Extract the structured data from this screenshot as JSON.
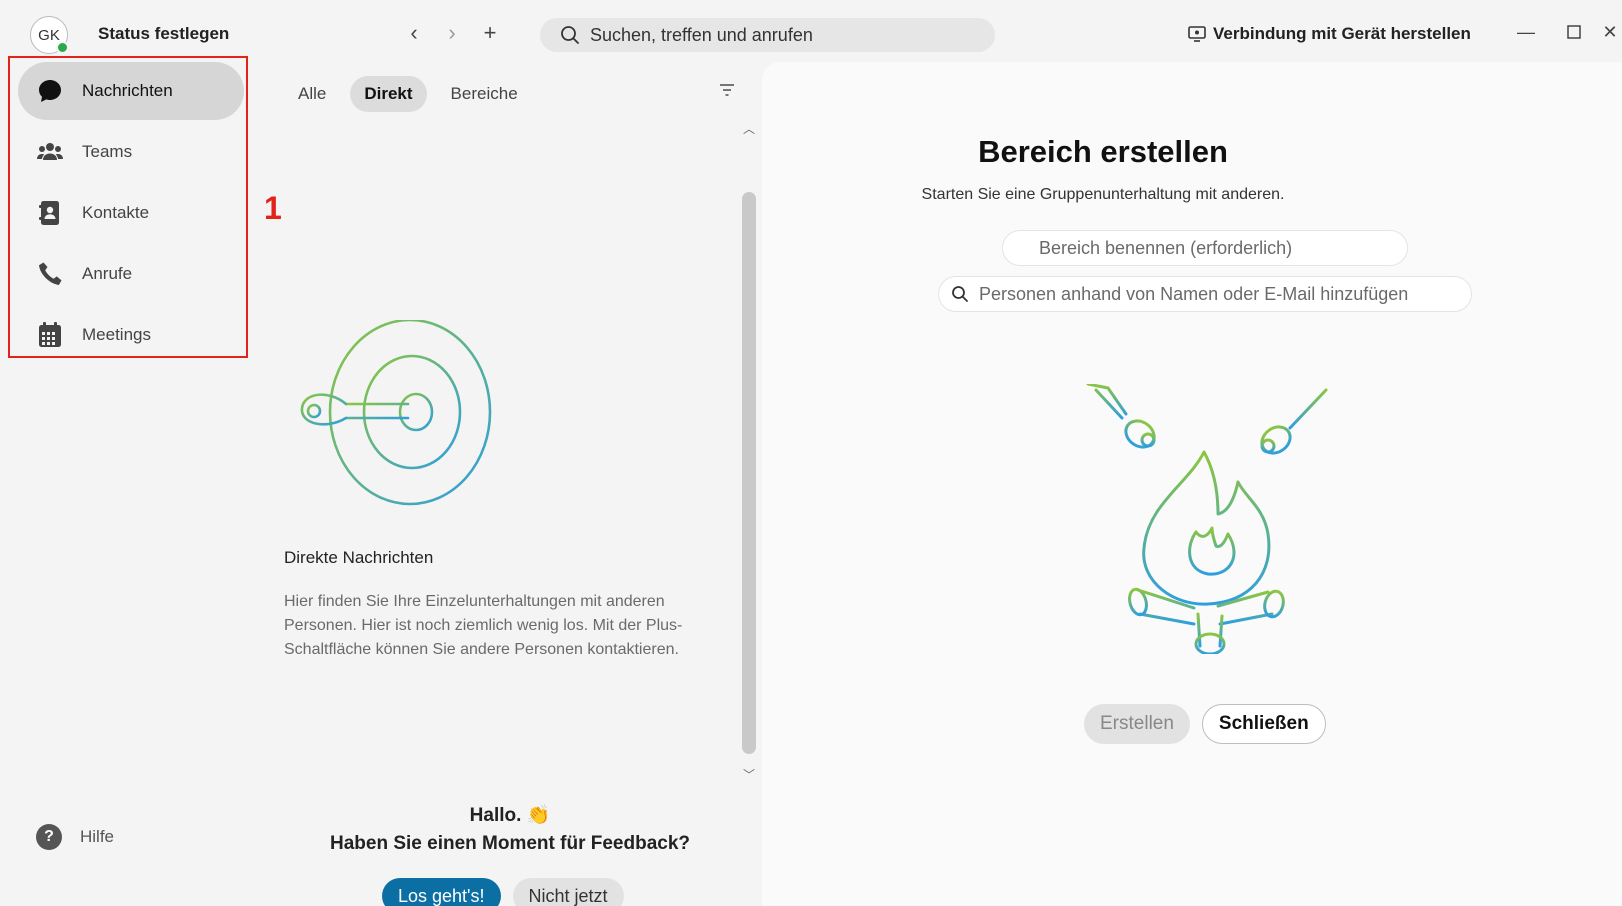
{
  "titlebar": {
    "avatar_initials": "GK",
    "status_label": "Status festlegen",
    "search_placeholder": "Suchen, treffen und anrufen",
    "connect_label": "Verbindung mit Gerät herstellen"
  },
  "sidebar": {
    "items": [
      {
        "label": "Nachrichten",
        "icon": "chat-bubble-icon",
        "active": true
      },
      {
        "label": "Teams",
        "icon": "people-icon",
        "active": false
      },
      {
        "label": "Kontakte",
        "icon": "contacts-book-icon",
        "active": false
      },
      {
        "label": "Anrufe",
        "icon": "phone-icon",
        "active": false
      },
      {
        "label": "Meetings",
        "icon": "calendar-icon",
        "active": false
      }
    ],
    "help_label": "Hilfe",
    "annotation_number": "1"
  },
  "list_panel": {
    "filters": [
      {
        "label": "Alle",
        "active": false
      },
      {
        "label": "Direkt",
        "active": true
      },
      {
        "label": "Bereiche",
        "active": false
      }
    ],
    "empty_title": "Direkte Nachrichten",
    "empty_description": "Hier finden Sie Ihre Einzelunterhaltungen mit anderen Personen. Hier ist noch ziemlich wenig los. Mit der Plus-Schaltfläche können Sie andere Personen kontaktieren.",
    "feedback_greeting": "Hallo. 👏",
    "feedback_question": "Haben Sie einen Moment für Feedback?",
    "feedback_yes": "Los geht's!",
    "feedback_no": "Nicht jetzt"
  },
  "create_space": {
    "title": "Bereich erstellen",
    "subtitle": "Starten Sie eine Gruppenunterhaltung mit anderen.",
    "name_placeholder": "Bereich benennen (erforderlich)",
    "people_placeholder": "Personen anhand von Namen oder E-Mail hinzufügen",
    "create_label": "Erstellen",
    "close_label": "Schließen"
  },
  "colors": {
    "accent": "#0b6fa4",
    "annotation": "#e2231a",
    "presence": "#2ba84a"
  }
}
